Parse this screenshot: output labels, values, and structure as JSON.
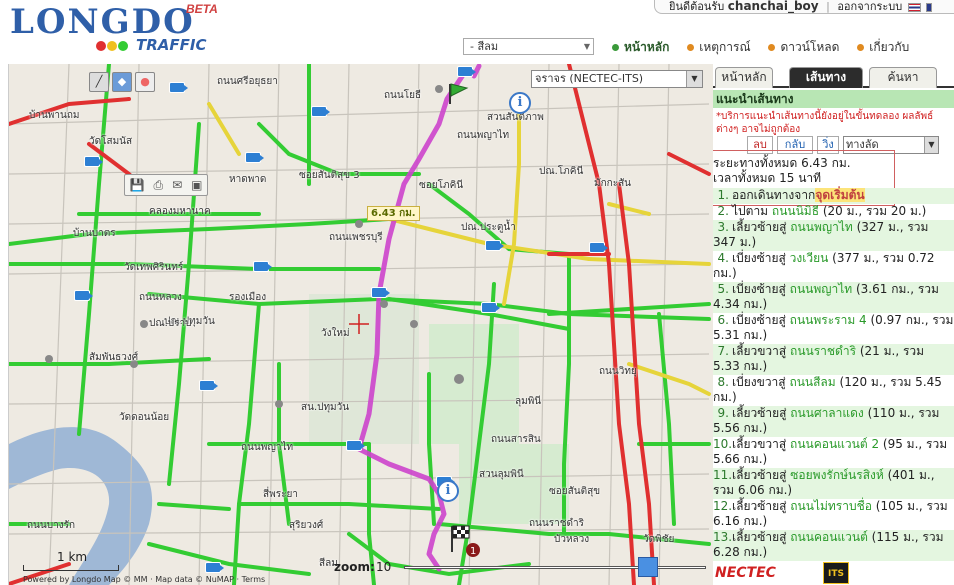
{
  "header": {
    "logo_text": "LONGDO",
    "logo_beta": "BETA",
    "logo_traffic": "TRAFFIC",
    "welcome_text": "ยินดีต้อนรับ",
    "username": "chanchai_boy",
    "logout_label": "ออกจากระบบ",
    "places_dropdown": "- สีลม",
    "nav": [
      {
        "label": "หน้าหลัก",
        "color": "#3a9a3a",
        "active": true
      },
      {
        "label": "เหตุการณ์",
        "color": "#e08a20",
        "active": false
      },
      {
        "label": "ดาวน์โหลด",
        "color": "#e08a20",
        "active": false
      },
      {
        "label": "เกี่ยวกับ",
        "color": "#e08a20",
        "active": false
      }
    ]
  },
  "map": {
    "layer_select": "จราจร (NECTEC-ITS)",
    "distance_label": "6.43 กม.",
    "scale_label": "1 km",
    "powered_by": "Powered by Longdo Map © MM · Map data © NuMAP · Terms",
    "zoom_label": "zoom:",
    "zoom_value": "10",
    "zoom_level": 0.83,
    "labels": [
      {
        "text": "บ้านพานถม",
        "id": "l1"
      },
      {
        "text": "ถนนศรีอยุธยา",
        "id": "l2"
      },
      {
        "text": "ถนนโยธี",
        "id": "l3"
      },
      {
        "text": "ถนนพญาไท",
        "id": "l4"
      },
      {
        "text": "สวนสันติภาพ",
        "id": "l5"
      },
      {
        "text": "วัดโสมนัส",
        "id": "l6"
      },
      {
        "text": "ซอยสันติสุข 3",
        "id": "l7"
      },
      {
        "text": "ซอยโภคินี",
        "id": "l8"
      },
      {
        "text": "ปณ.โภคินี",
        "id": "l9"
      },
      {
        "text": "มักกะสัน",
        "id": "l10"
      },
      {
        "text": "หาดพาด",
        "id": "l11"
      },
      {
        "text": "คลองมหานาค",
        "id": "l12"
      },
      {
        "text": "ถนนเพชรบุรี",
        "id": "l13"
      },
      {
        "text": "ปณ.ประตูน้ำ",
        "id": "l14"
      },
      {
        "text": "บ้านบาตร",
        "id": "l15"
      },
      {
        "text": "วัดเทพศิรินทร์",
        "id": "l16"
      },
      {
        "text": "ถนนหลวง",
        "id": "l17"
      },
      {
        "text": "รองเมือง",
        "id": "l18"
      },
      {
        "text": "ปณ.ปทุมวัน",
        "id": "l19"
      },
      {
        "text": "วังใหม่",
        "id": "l20"
      },
      {
        "text": "ปณ.ปราบ",
        "id": "l21"
      },
      {
        "text": "สัมพันธวงศ์",
        "id": "l22"
      },
      {
        "text": "ลุมพินี",
        "id": "l23"
      },
      {
        "text": "วัดดอนน้อย",
        "id": "l24"
      },
      {
        "text": "สน.ปทุมวัน",
        "id": "l25"
      },
      {
        "text": "ถนนพญาไท",
        "id": "l26"
      },
      {
        "text": "ถนนสารสิน",
        "id": "l27"
      },
      {
        "text": "สวนลุมพินี",
        "id": "l28"
      },
      {
        "text": "สี่พระยา",
        "id": "l29"
      },
      {
        "text": "สุริยวงศ์",
        "id": "l30"
      },
      {
        "text": "ถนนราชดำริ",
        "id": "l31"
      },
      {
        "text": "ถนนบางรัก",
        "id": "l32"
      },
      {
        "text": "สีลม",
        "id": "l33"
      },
      {
        "text": "วัดพิชัย",
        "id": "l34"
      },
      {
        "text": "บัวหลวง",
        "id": "l35"
      },
      {
        "text": "ซอยสันติสุข",
        "id": "l36"
      },
      {
        "text": "ถนนวิทยุ",
        "id": "l37"
      }
    ]
  },
  "panel": {
    "tabs": [
      {
        "label": "หน้าหลัก",
        "active": false
      },
      {
        "label": "เส้นทาง",
        "active": true
      },
      {
        "label": "ค้นหา",
        "active": false
      }
    ],
    "route_heading": "แนะนำเส้นทาง",
    "notice": "*บริการแนะนำเส้นทางนี้ยังอยู่ในขั้นทดลอง ผลลัพธ์ต่างๆ อาจไม่ถูกต้อง",
    "btn_delete": "ลบ",
    "btn_back": "กลับ",
    "btn_run": "วิ่ง",
    "route_mode": "ทางลัด",
    "total_distance": "ระยะทางทั้งหมด 6.43 กม.",
    "total_time": "เวลาทั้งหมด 15 นาที",
    "steps": [
      {
        "num": "1.",
        "prefix": "ออกเดินทางจาก",
        "road": "จุดเริ่มต้น",
        "suffix": "",
        "first": true
      },
      {
        "num": "2.",
        "prefix": "ไปตาม ",
        "road": "ถนนนิมิธี",
        "suffix": " (20 ม., รวม 20 ม.)"
      },
      {
        "num": "3.",
        "prefix": "เลี้ยวซ้ายสู่ ",
        "road": "ถนนพญาไท",
        "suffix": " (327 ม., รวม 347 ม.)"
      },
      {
        "num": "4.",
        "prefix": "เบี่ยงซ้ายสู่ ",
        "road": "วงเวียน",
        "suffix": " (377 ม., รวม 0.72 กม.)"
      },
      {
        "num": "5.",
        "prefix": "เบี่ยงซ้ายสู่ ",
        "road": "ถนนพญาไท",
        "suffix": " (3.61 กม., รวม 4.34 กม.)"
      },
      {
        "num": "6.",
        "prefix": "เบี่ยงซ้ายสู่ ",
        "road": "ถนนพระราม 4",
        "suffix": " (0.97 กม., รวม 5.31 กม.)"
      },
      {
        "num": "7.",
        "prefix": "เลี้ยวขวาสู่ ",
        "road": "ถนนราชดำริ",
        "suffix": " (21 ม., รวม 5.33 กม.)"
      },
      {
        "num": "8.",
        "prefix": "เบี่ยงขวาสู่ ",
        "road": "ถนนสีลม",
        "suffix": " (120 ม., รวม 5.45 กม.)"
      },
      {
        "num": "9.",
        "prefix": "เลี้ยวซ้ายสู่ ",
        "road": "ถนนศาลาแดง",
        "suffix": " (110 ม., รวม 5.56 กม.)"
      },
      {
        "num": "10.",
        "prefix": "เลี้ยวขวาสู่ ",
        "road": "ถนนคอนแวนต์ 2",
        "suffix": " (95 ม., รวม 5.66 กม.)"
      },
      {
        "num": "11.",
        "prefix": "เลี้ยวซ้ายสู่ ",
        "road": "ซอยพงรักษ์นรสิงห์",
        "suffix": " (401 ม., รวม 6.06 กม.)"
      },
      {
        "num": "12.",
        "prefix": "เลี้ยวซ้ายสู่ ",
        "road": "ถนนไม่ทราบชื่อ",
        "suffix": " (105 ม., รวม 6.16 กม.)"
      },
      {
        "num": "13.",
        "prefix": "เลี้ยวซ้ายสู่ ",
        "road": "ถนนคอนแวนต์",
        "suffix": " (115 ม., รวม 6.28 กม.)"
      }
    ],
    "logo_nectec": "NECTEC",
    "logo_its": "ITS"
  },
  "colors": {
    "route": "#cc44cc",
    "traffic_fast": "#33cc33",
    "traffic_medium": "#e6d43a",
    "traffic_slow": "#e03030",
    "camera": "#2d7fd3"
  }
}
